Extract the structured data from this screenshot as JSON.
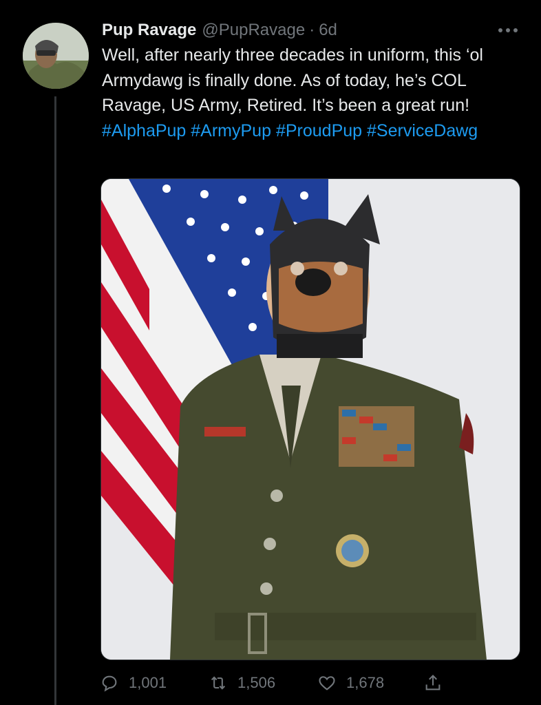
{
  "tweet": {
    "author_name": "Pup Ravage",
    "handle": "@PupRavage",
    "separator": "·",
    "time": "6d",
    "text_intro": "Well, after nearly three decades in uniform, this ‘ol Armydawg is finally done. As of today, he’s COL Ravage, US Army, Retired. It’s been a great run!",
    "hashtags": [
      "#AlphaPup",
      "#ArmyPup",
      "#ProudPup",
      "#ServiceDawg"
    ]
  },
  "actions": {
    "replies": "1,001",
    "retweets": "1,506",
    "likes": "1,678"
  },
  "icons": {
    "more": "more-dots-icon",
    "reply": "reply-bubble-icon",
    "retweet": "retweet-icon",
    "like": "heart-icon",
    "share": "share-icon"
  },
  "colors": {
    "link": "#1d9bf0",
    "muted": "#71767b",
    "text": "#e7e9ea",
    "background": "#000000"
  }
}
